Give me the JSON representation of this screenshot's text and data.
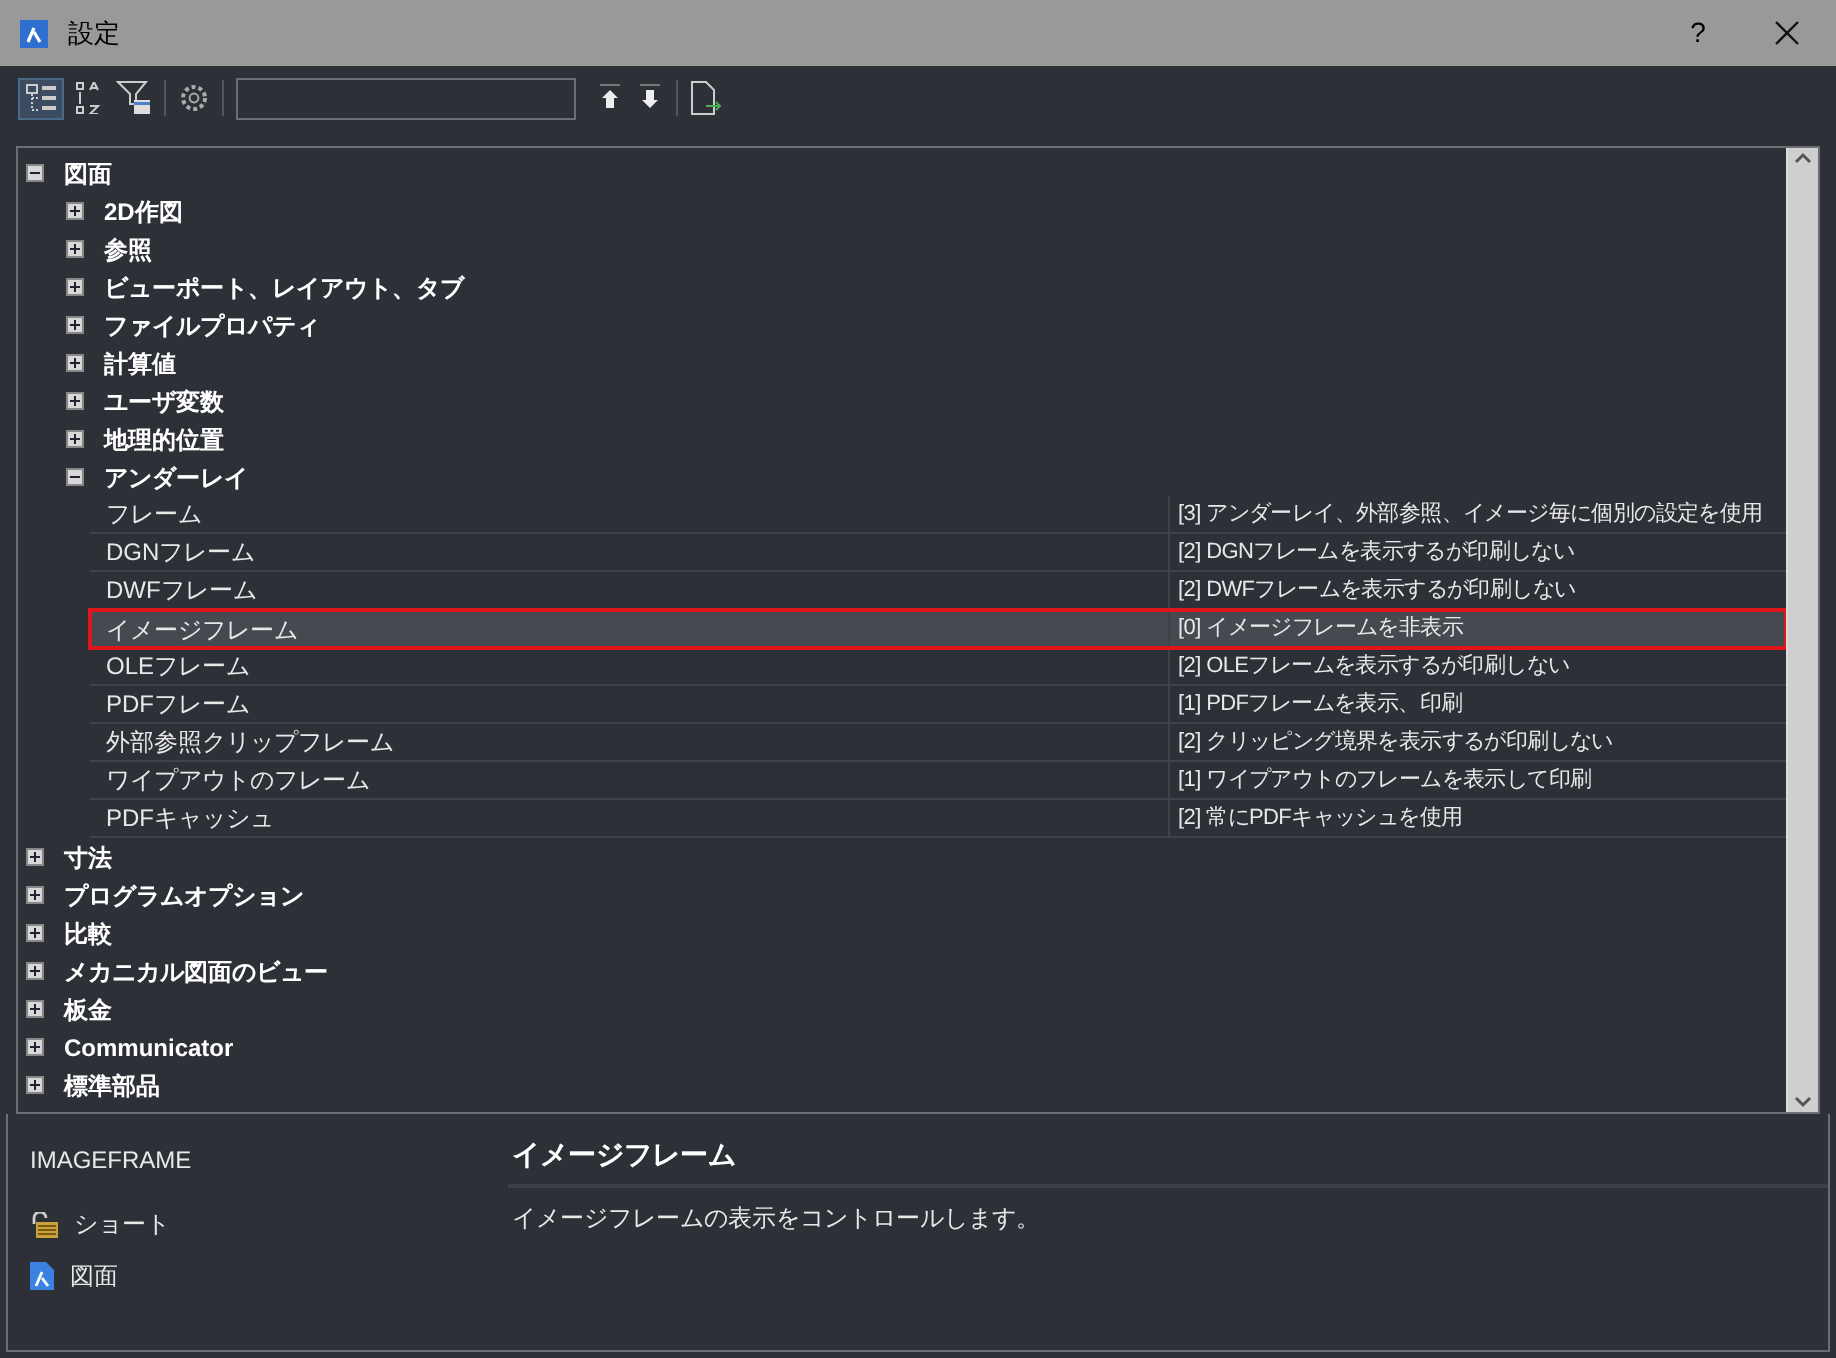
{
  "window": {
    "title": "設定",
    "help": "?"
  },
  "toolbar": {
    "view_toggle_selected": true
  },
  "tree": [
    {
      "label": "図面",
      "expanded": true,
      "children": [
        {
          "label": "2D作図",
          "expanded": false
        },
        {
          "label": "参照",
          "expanded": false
        },
        {
          "label": "ビューポート、レイアウト、タブ",
          "expanded": false
        },
        {
          "label": "ファイルプロパティ",
          "expanded": false
        },
        {
          "label": "計算値",
          "expanded": false
        },
        {
          "label": "ユーザ変数",
          "expanded": false
        },
        {
          "label": "地理的位置",
          "expanded": false
        },
        {
          "label": "アンダーレイ",
          "expanded": true,
          "properties": [
            {
              "name": "フレーム",
              "value": "[3] アンダーレイ、外部参照、イメージ毎に個別の設定を使用",
              "selected": false
            },
            {
              "name": "DGNフレーム",
              "value": "[2] DGNフレームを表示するが印刷しない",
              "selected": false
            },
            {
              "name": "DWFフレーム",
              "value": "[2] DWFフレームを表示するが印刷しない",
              "selected": false
            },
            {
              "name": "イメージフレーム",
              "value": "[0] イメージフレームを非表示",
              "selected": true
            },
            {
              "name": "OLEフレーム",
              "value": "[2] OLEフレームを表示するが印刷しない",
              "selected": false
            },
            {
              "name": "PDFフレーム",
              "value": "[1] PDFフレームを表示、印刷",
              "selected": false
            },
            {
              "name": "外部参照クリップフレーム",
              "value": "[2] クリッピング境界を表示するが印刷しない",
              "selected": false
            },
            {
              "name": "ワイプアウトのフレーム",
              "value": "[1] ワイプアウトのフレームを表示して印刷",
              "selected": false
            },
            {
              "name": "PDFキャッシュ",
              "value": "[2] 常にPDFキャッシュを使用",
              "selected": false
            }
          ]
        }
      ]
    },
    {
      "label": "寸法",
      "expanded": false
    },
    {
      "label": "プログラムオプション",
      "expanded": false
    },
    {
      "label": "比較",
      "expanded": false
    },
    {
      "label": "メカニカル図面のビュー",
      "expanded": false
    },
    {
      "label": "板金",
      "expanded": false
    },
    {
      "label": "Communicator",
      "expanded": false
    },
    {
      "label": "標準部品",
      "expanded": false
    }
  ],
  "details": {
    "variable": "IMAGEFRAME",
    "scope": [
      {
        "kind": "lock",
        "label": "ショート"
      },
      {
        "kind": "drawing",
        "label": "図面"
      }
    ],
    "title": "イメージフレーム",
    "description": "イメージフレームの表示をコントロールします。"
  }
}
